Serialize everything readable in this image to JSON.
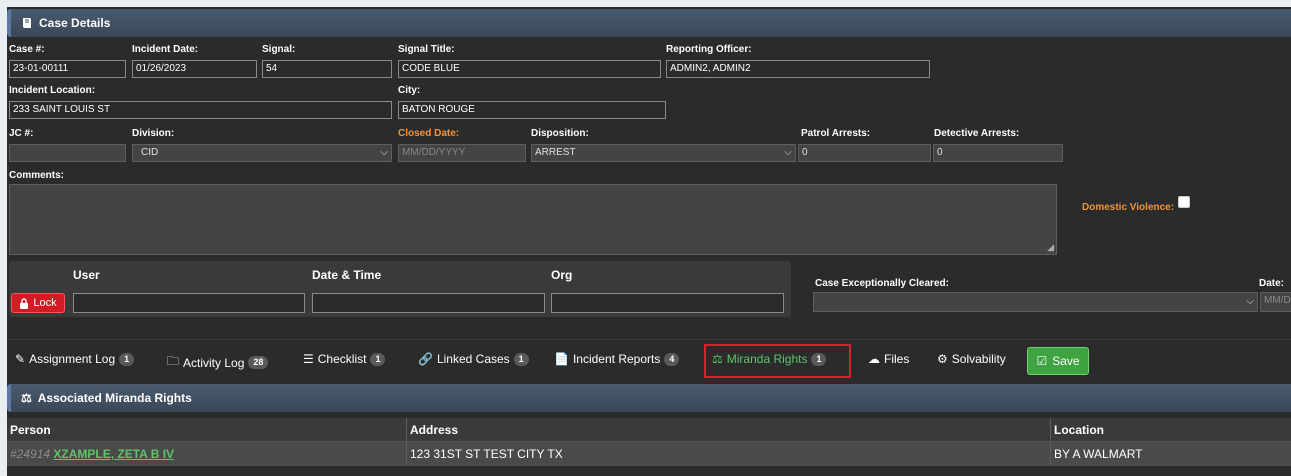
{
  "case_details": {
    "title": "Case Details",
    "case_no_label": "Case #:",
    "case_no": "23-01-00111",
    "incident_date_label": "Incident Date:",
    "incident_date": "01/26/2023",
    "signal_label": "Signal:",
    "signal": "54",
    "signal_title_label": "Signal Title:",
    "signal_title": "CODE BLUE",
    "reporting_officer_label": "Reporting Officer:",
    "reporting_officer": "ADMIN2, ADMIN2",
    "incident_location_label": "Incident Location:",
    "incident_location": "233 SAINT LOUIS ST",
    "city_label": "City:",
    "city": "BATON ROUGE",
    "jc_label": "JC #:",
    "jc": "",
    "division_label": "Division:",
    "division": "CID",
    "closed_date_label": "Closed Date:",
    "closed_date_placeholder": "MM/DD/YYYY",
    "disposition_label": "Disposition:",
    "disposition": "ARREST",
    "patrol_arrests_label": "Patrol Arrests:",
    "patrol_arrests": "0",
    "detective_arrests_label": "Detective Arrests:",
    "detective_arrests": "0",
    "comments_label": "Comments:",
    "domestic_violence_label": "Domestic Violence:"
  },
  "lock": {
    "col_user": "User",
    "col_datetime": "Date & Time",
    "col_org": "Org",
    "lock_label": "Lock"
  },
  "cleared": {
    "label": "Case Exceptionally Cleared:",
    "date_label": "Date:",
    "date_placeholder": "MM/DD/YYYY"
  },
  "tabs": [
    {
      "label": "Assignment Log",
      "count": "1"
    },
    {
      "label": "Activity Log",
      "count": "28"
    },
    {
      "label": "Checklist",
      "count": "1"
    },
    {
      "label": "Linked Cases",
      "count": "1"
    },
    {
      "label": "Incident Reports",
      "count": "4"
    },
    {
      "label": "Miranda Rights",
      "count": "1"
    },
    {
      "label": "Files"
    },
    {
      "label": "Solvability"
    }
  ],
  "save_label": "Save",
  "miranda": {
    "title": "Associated Miranda Rights",
    "columns": [
      "Person",
      "Address",
      "Location"
    ],
    "rows": [
      {
        "id": "#24914",
        "person": "XZAMPLE, ZETA B IV",
        "address": "123 31ST ST TEST CITY TX",
        "location": "BY A WALMART"
      }
    ]
  },
  "colors": {
    "accent_green": "#5fc36a",
    "orange_label": "#f0943c",
    "lock_red": "#d21c24",
    "save_green": "#3ea340",
    "highlight_red": "#d9232a"
  }
}
